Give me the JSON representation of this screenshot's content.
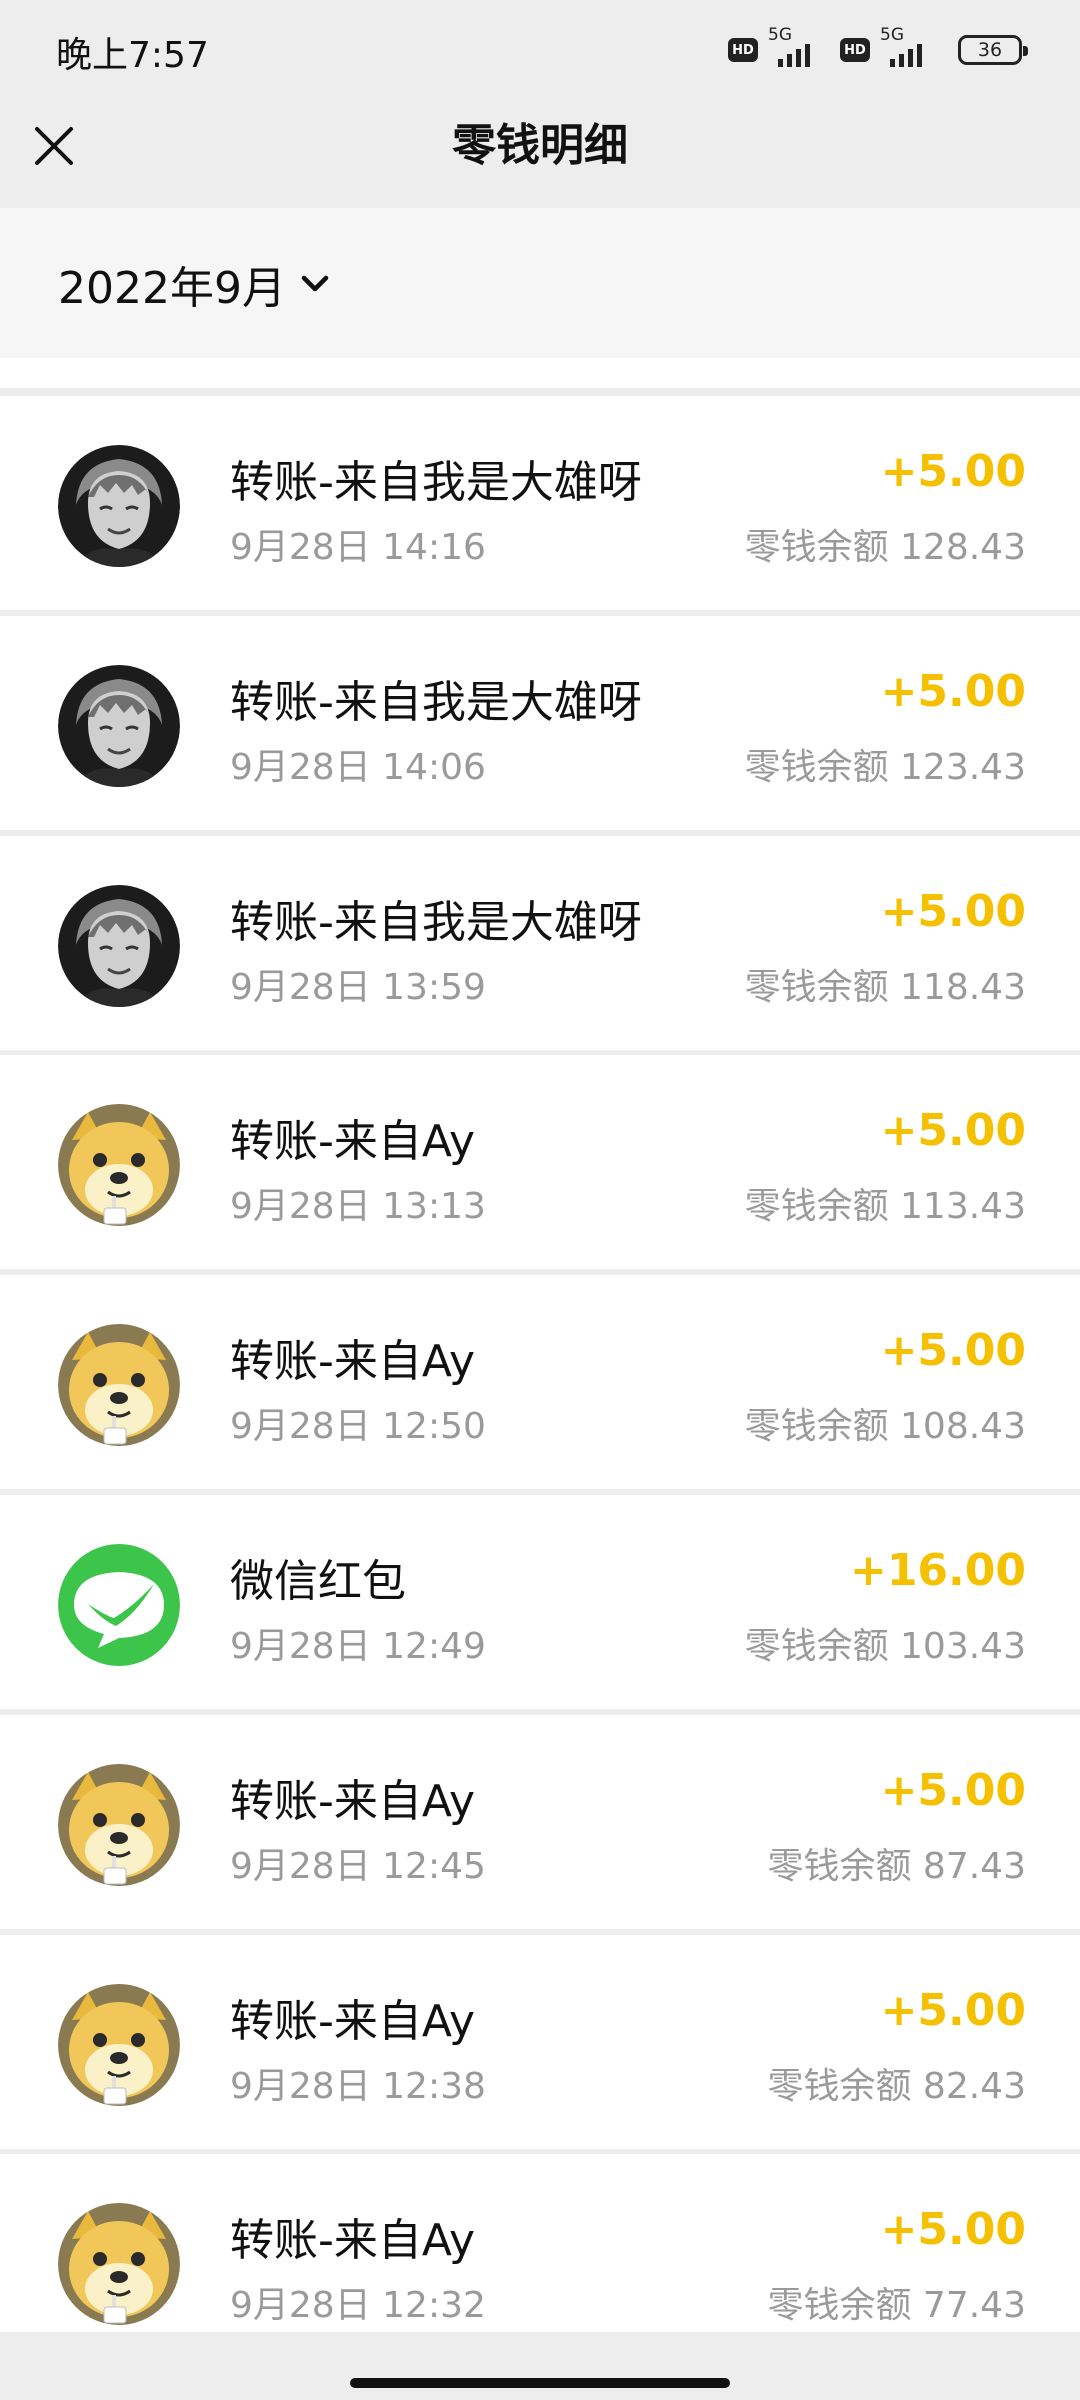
{
  "status_bar": {
    "time": "晚上7:57",
    "sim1": {
      "hd": "HD",
      "network": "5G"
    },
    "sim2": {
      "hd": "HD",
      "network": "5G"
    },
    "battery": "36"
  },
  "nav": {
    "title": "零钱明细",
    "close_icon": "close-icon"
  },
  "filter": {
    "month": "2022年9月",
    "dropdown_icon": "chevron-down-icon"
  },
  "colors": {
    "amount": "#f5c000",
    "secondary_text": "#9a9a9a",
    "wechat_green": "#3dc44a"
  },
  "records": [
    {
      "title": "转账-来自我是大雄呀",
      "time": "9月28日 14:16",
      "amount": "+5.00",
      "balance": "零钱余额 128.43",
      "avatar": "anime-avatar"
    },
    {
      "title": "转账-来自我是大雄呀",
      "time": "9月28日 14:06",
      "amount": "+5.00",
      "balance": "零钱余额 123.43",
      "avatar": "anime-avatar"
    },
    {
      "title": "转账-来自我是大雄呀",
      "time": "9月28日 13:59",
      "amount": "+5.00",
      "balance": "零钱余额 118.43",
      "avatar": "anime-avatar"
    },
    {
      "title": "转账-来自Ay",
      "time": "9月28日 13:13",
      "amount": "+5.00",
      "balance": "零钱余额 113.43",
      "avatar": "doge-avatar"
    },
    {
      "title": "转账-来自Ay",
      "time": "9月28日 12:50",
      "amount": "+5.00",
      "balance": "零钱余额 108.43",
      "avatar": "doge-avatar"
    },
    {
      "title": "微信红包",
      "time": "9月28日 12:49",
      "amount": "+16.00",
      "balance": "零钱余额 103.43",
      "avatar": "wechat-avatar"
    },
    {
      "title": "转账-来自Ay",
      "time": "9月28日 12:45",
      "amount": "+5.00",
      "balance": "零钱余额 87.43",
      "avatar": "doge-avatar"
    },
    {
      "title": "转账-来自Ay",
      "time": "9月28日 12:38",
      "amount": "+5.00",
      "balance": "零钱余额 82.43",
      "avatar": "doge-avatar"
    },
    {
      "title": "转账-来自Ay",
      "time": "9月28日 12:32",
      "amount": "+5.00",
      "balance": "零钱余额 77.43",
      "avatar": "doge-avatar"
    }
  ]
}
